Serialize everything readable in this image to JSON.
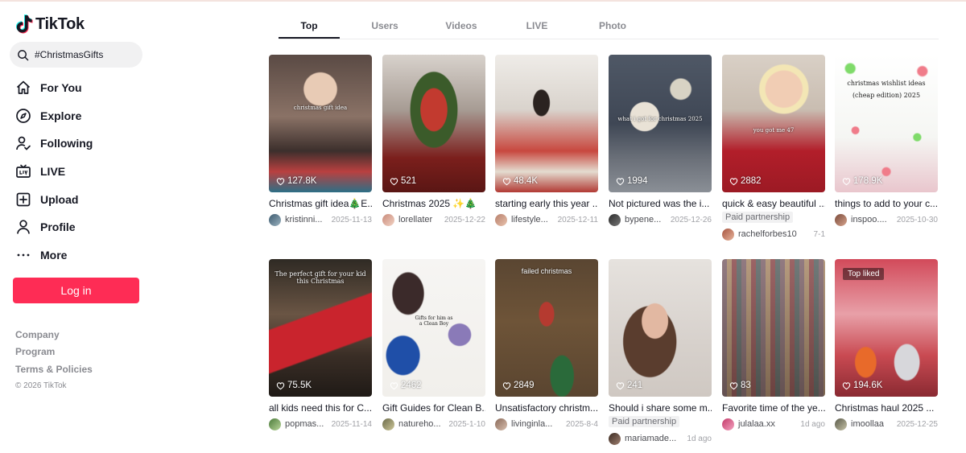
{
  "brand": {
    "name": "TikTok"
  },
  "search": {
    "value": "#ChristmasGifts"
  },
  "nav": [
    {
      "label": "For You",
      "icon": "home-icon"
    },
    {
      "label": "Explore",
      "icon": "compass-icon"
    },
    {
      "label": "Following",
      "icon": "following-icon"
    },
    {
      "label": "LIVE",
      "icon": "live-icon"
    },
    {
      "label": "Upload",
      "icon": "upload-icon"
    },
    {
      "label": "Profile",
      "icon": "profile-icon"
    },
    {
      "label": "More",
      "icon": "more-icon"
    }
  ],
  "login": {
    "label": "Log in"
  },
  "footer": {
    "links": [
      "Company",
      "Program",
      "Terms & Policies"
    ],
    "copyright": "© 2026 TikTok"
  },
  "tabs": [
    "Top",
    "Users",
    "Videos",
    "LIVE",
    "Photo"
  ],
  "active_tab": "Top",
  "colors": {
    "accent": "#fe2c55",
    "text": "#161823",
    "muted": "#8a8b91"
  },
  "videos": [
    {
      "views": "127.8K",
      "desc": "Christmas gift idea🎄E...",
      "author": "kristinni...",
      "date": "2025-11-13",
      "overlay": "christmas gift idea",
      "badge": "",
      "paid": ""
    },
    {
      "views": "521",
      "desc": "Christmas 2025 ✨🎄",
      "author": "lorellater",
      "date": "2025-12-22",
      "overlay": "",
      "badge": "",
      "paid": ""
    },
    {
      "views": "48.4K",
      "desc": "starting early this year ...",
      "author": "lifestyle...",
      "date": "2025-12-11",
      "overlay": "",
      "badge": "",
      "paid": ""
    },
    {
      "views": "1994",
      "desc": "Not pictured was the i...",
      "author": "bypene...",
      "date": "2025-12-26",
      "overlay": "what i got for christmas 2025",
      "badge": "",
      "paid": ""
    },
    {
      "views": "2882",
      "desc": "quick & easy beautiful ...",
      "author": "rachelforbes10",
      "date": "7-1",
      "overlay": "you got me 47",
      "badge": "",
      "paid": "Paid partnership"
    },
    {
      "views": "178.9K",
      "desc": "things to add to your c...",
      "author": "inspoo....",
      "date": "2025-10-30",
      "overlay": "christmas wishlist ideas (cheap edition) 2025",
      "badge": "",
      "paid": ""
    },
    {
      "views": "75.5K",
      "desc": "all kids need this for C...",
      "author": "popmas...",
      "date": "2025-11-14",
      "overlay": "The perfect gift for your kid this Christmas",
      "badge": "",
      "paid": ""
    },
    {
      "views": "2462",
      "desc": "Gift Guides for Clean B...",
      "author": "natureho...",
      "date": "2025-1-10",
      "overlay": "Gifts for him as a Clean Boy",
      "badge": "",
      "paid": ""
    },
    {
      "views": "2849",
      "desc": "Unsatisfactory christm...",
      "author": "livinginla...",
      "date": "2025-8-4",
      "overlay": "failed christmas",
      "badge": "",
      "paid": ""
    },
    {
      "views": "241",
      "desc": "Should i share some m...",
      "author": "mariamade...",
      "date": "1d ago",
      "overlay": "",
      "badge": "",
      "paid": "Paid partnership"
    },
    {
      "views": "83",
      "desc": "Favorite time of the ye...",
      "author": "julalaa.xx",
      "date": "1d ago",
      "overlay": "",
      "badge": "",
      "paid": ""
    },
    {
      "views": "194.6K",
      "desc": "Christmas haul 2025 ...",
      "author": "imoollaa",
      "date": "2025-12-25",
      "overlay": "",
      "badge": "Top liked",
      "paid": ""
    }
  ]
}
